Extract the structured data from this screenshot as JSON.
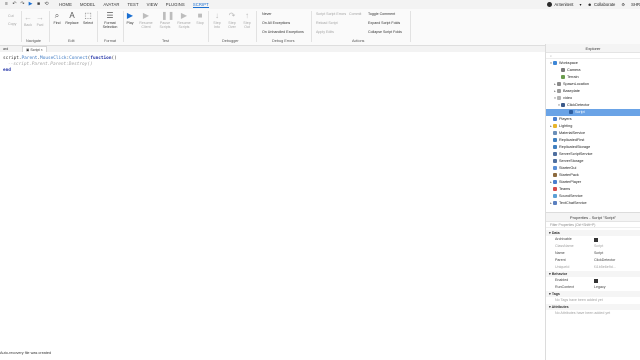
{
  "topbar": {
    "menu": [
      "HOME",
      "MODEL",
      "AVATAR",
      "TEST",
      "VIEW",
      "PLUGINS",
      "SCRIPT"
    ],
    "user": "Ar4enitent",
    "collaborate": "Collaborate",
    "share": "SHR"
  },
  "ribbon": {
    "clipboard": {
      "cut": "Cut",
      "copy": "Copy",
      "label": ""
    },
    "navigate": {
      "back": "Back",
      "fwd": "Fwd",
      "label": "Navigate"
    },
    "edit": {
      "find": "Find",
      "replace": "Replace",
      "select": "Select",
      "label": "Edit"
    },
    "format": {
      "format_selection": "Format Selection",
      "label": "Format"
    },
    "test": {
      "play": "Play",
      "run": "Resume Client",
      "pause": "Pause Scripts",
      "resume": "Resume Scripts",
      "stop": "Stop",
      "label": "Test"
    },
    "debugger": {
      "step_into": "Step Into",
      "step_over": "Step Over",
      "step_out": "Step Out",
      "label": "Debugger"
    },
    "debug_errors": {
      "never": "Never",
      "all": "On All Exceptions",
      "unhandled": "On Unhandled Exceptions",
      "label": "Debug Errors"
    },
    "actions": {
      "script_errors": "Script Script Errors",
      "reload": "Reload Script",
      "apply": "Apply Edits",
      "commit": "Commit",
      "toggle_comment": "Toggle Comment",
      "expand": "Expand Script Folds",
      "collapse": "Collapse Script Folds",
      "label": "Actions"
    }
  },
  "tabs": {
    "left": "ard",
    "second": "Script"
  },
  "code": {
    "line1_a": "script.",
    "line1_b": "Parent",
    "line1_c": ".",
    "line1_d": "MouseClick",
    "line1_e": ":",
    "line1_f": "Connect",
    "line1_g": "(",
    "line1_h": "function",
    "line1_i": "()",
    "line2": "--script.Parent.Parent:Destroy()",
    "line3": "end"
  },
  "status": "Auto-recovery file was created",
  "explorer": {
    "title": "Explorer",
    "filter": "Filter workspace (Ctrl+Shift+X)",
    "nodes": [
      "Workspace",
      "Camera",
      "Terrain",
      "SpawnLocation",
      "Baseplate",
      "video",
      "ClickDetector",
      "Script",
      "Players",
      "Lighting",
      "MaterialService",
      "ReplicatedFirst",
      "ReplicatedStorage",
      "ServerScriptService",
      "ServerStorage",
      "StarterGui",
      "StarterPack",
      "StarterPlayer",
      "Teams",
      "SoundService",
      "TextChatService"
    ]
  },
  "properties": {
    "title": "Properties - Script \"Script\"",
    "filter": "Filter Properties (Ctrl+Shift+P)",
    "data_label": "Data",
    "rows": [
      {
        "k": "Archivable",
        "v": ""
      },
      {
        "k": "ClassName",
        "v": "Script"
      },
      {
        "k": "Name",
        "v": "Script"
      },
      {
        "k": "Parent",
        "v": "ClickDetector"
      },
      {
        "k": "UniqueId",
        "v": "f11b5e6e9d..."
      }
    ],
    "behavior_label": "Behavior",
    "enabled": "Enabled",
    "runcontext": "RunContext",
    "runcontext_value": "Legacy",
    "tags_label": "Tags",
    "tags_note": "No Tags have been added yet",
    "attrs_label": "Attributes",
    "attrs_note": "No Attributes have been added yet"
  }
}
